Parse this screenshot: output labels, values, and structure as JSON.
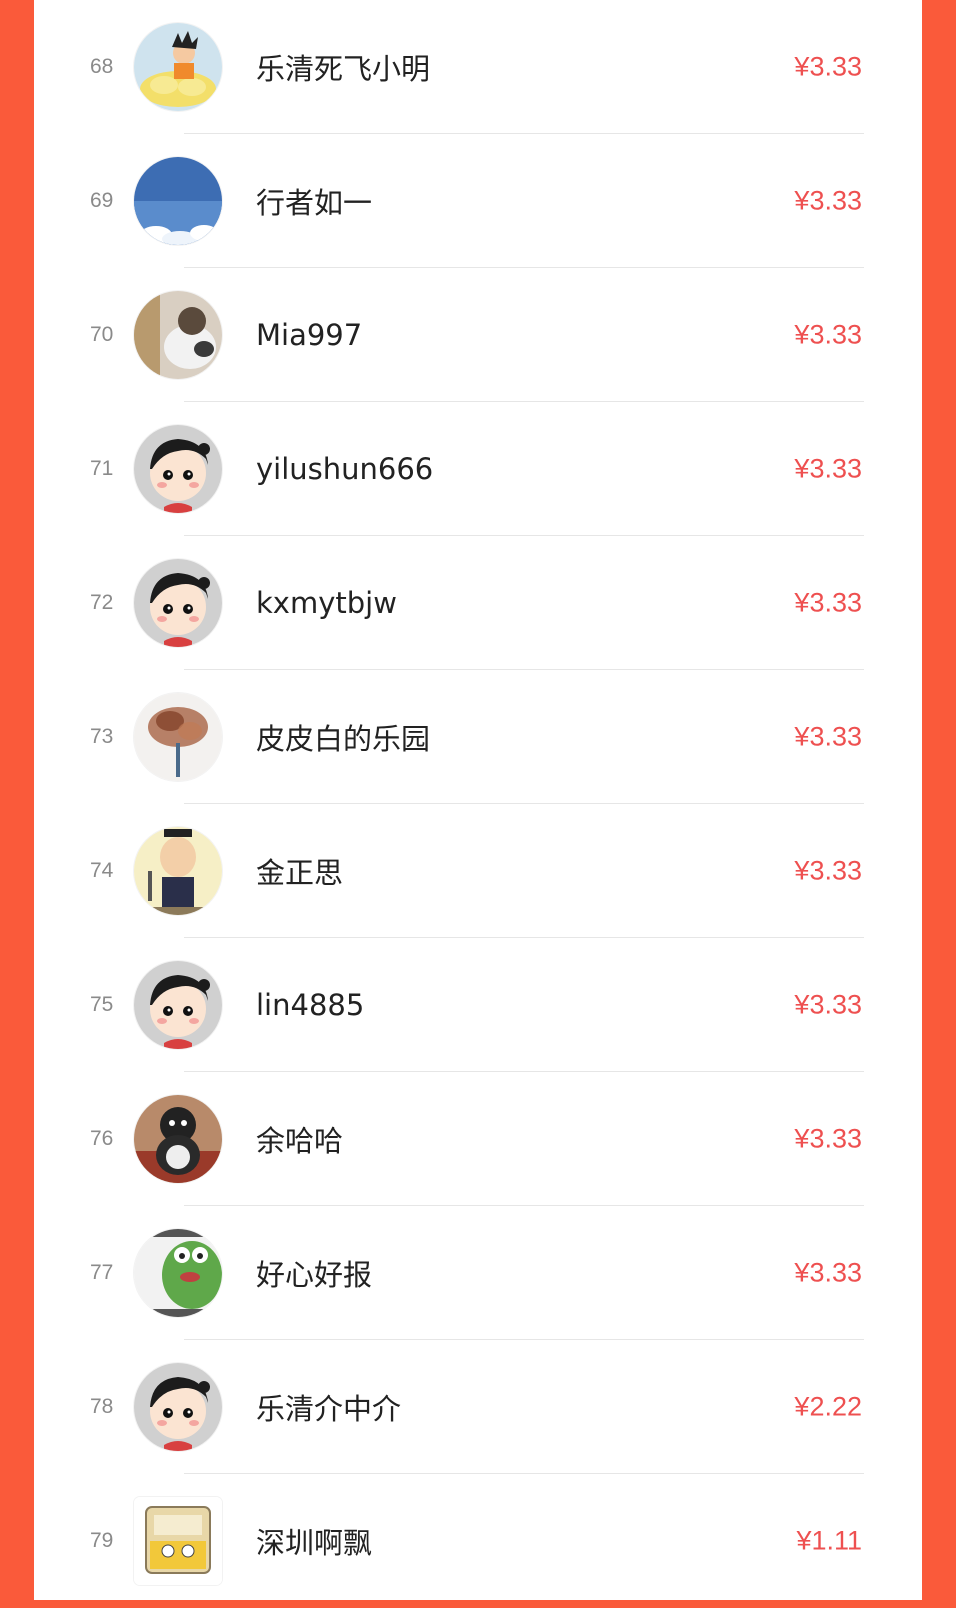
{
  "theme": {
    "accent": "#fa5a3a",
    "amount_color": "#ee5050"
  },
  "rows": [
    {
      "rank": "68",
      "name": "乐清死飞小明",
      "amount": "¥3.33",
      "avatar": "cartoon-boy-on-cloud-avatar"
    },
    {
      "rank": "69",
      "name": "行者如一",
      "amount": "¥3.33",
      "avatar": "blue-sky-avatar"
    },
    {
      "rank": "70",
      "name": "Mia997",
      "amount": "¥3.33",
      "avatar": "cat-photo-avatar"
    },
    {
      "rank": "71",
      "name": "yilushun666",
      "amount": "¥3.33",
      "avatar": "default-cartoon-avatar"
    },
    {
      "rank": "72",
      "name": "kxmytbjw",
      "amount": "¥3.33",
      "avatar": "default-cartoon-avatar"
    },
    {
      "rank": "73",
      "name": "皮皮白的乐园",
      "amount": "¥3.33",
      "avatar": "dried-flowers-avatar"
    },
    {
      "rank": "74",
      "name": "金正思",
      "amount": "¥3.33",
      "avatar": "cartoon-man-avatar"
    },
    {
      "rank": "75",
      "name": "lin4885",
      "amount": "¥3.33",
      "avatar": "default-cartoon-avatar"
    },
    {
      "rank": "76",
      "name": "余哈哈",
      "amount": "¥3.33",
      "avatar": "plush-toy-avatar"
    },
    {
      "rank": "77",
      "name": "好心好报",
      "amount": "¥3.33",
      "avatar": "green-frog-avatar"
    },
    {
      "rank": "78",
      "name": "乐清介中介",
      "amount": "¥2.22",
      "avatar": "default-cartoon-avatar"
    },
    {
      "rank": "79",
      "name": "深圳啊飘",
      "amount": "¥1.11",
      "avatar": "cartoon-bed-avatar"
    }
  ]
}
